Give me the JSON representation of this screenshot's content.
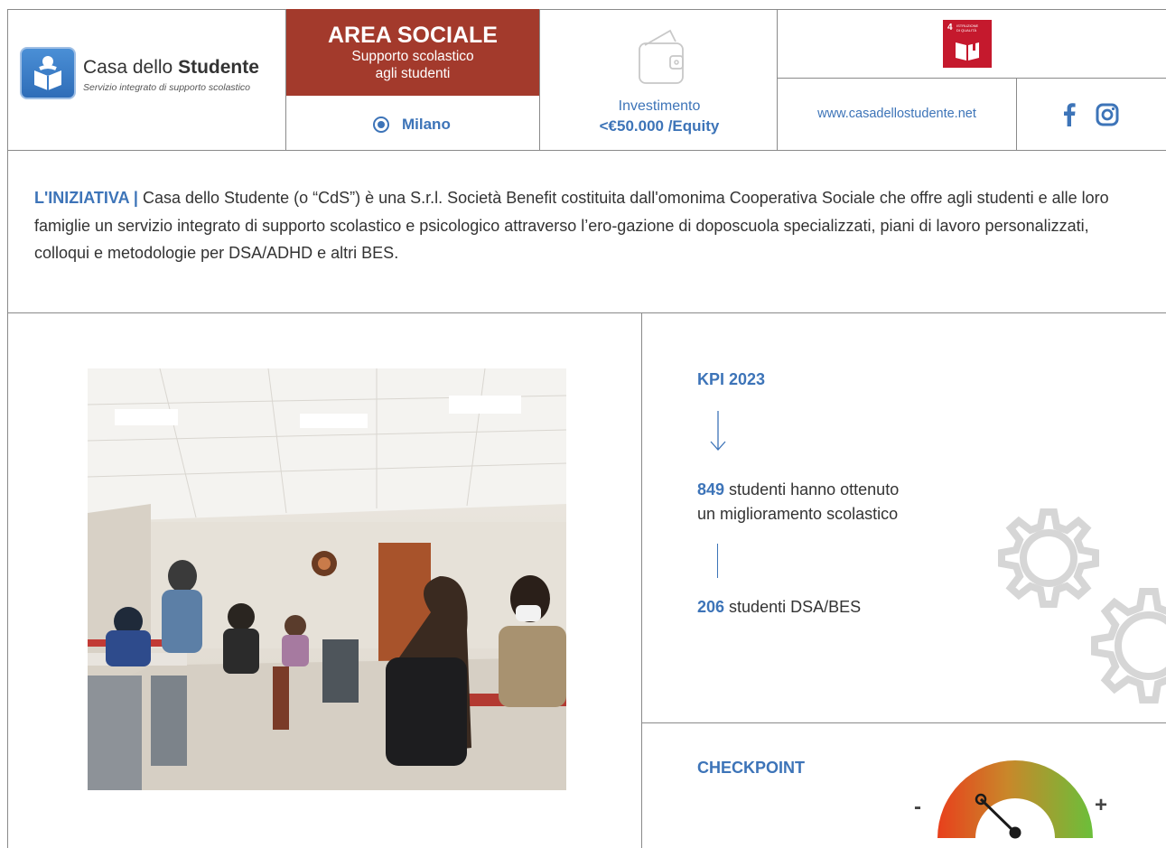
{
  "brand": {
    "name_prefix": "Casa dello ",
    "name_bold": "Studente",
    "tagline": "Servizio integrato di supporto scolastico",
    "logo_icon": "student-reading-book-icon"
  },
  "area": {
    "title": "AREA SOCIALE",
    "subtitle_line1": "Supporto scolastico",
    "subtitle_line2": "agli studenti",
    "color": "#a33a2c"
  },
  "location": {
    "icon": "location-target-icon",
    "label": "Milano"
  },
  "investment": {
    "icon": "wallet-icon",
    "label": "Investimento",
    "value": "<€50.000 /Equity"
  },
  "sdg": {
    "number": "4",
    "text_line1": "ISTRUZIONE",
    "text_line2": "DI QUALITÀ",
    "color": "#c5192d",
    "icon": "open-book-icon"
  },
  "website": "www.casadellostudente.net",
  "social": {
    "facebook_icon": "facebook-icon",
    "instagram_icon": "instagram-icon"
  },
  "initiative": {
    "label": "L'INIZIATIVA |",
    "text": " Casa dello Studente (o “CdS”) è una S.r.l. Società Benefit costituita dall'omonima Cooperativa Sociale che offre agli studenti e alle loro famiglie un servizio integrato di supporto scolastico e psicologico attraverso l’ero-gazione di doposcuola specializzati, piani di lavoro personalizzati, colloqui e metodologie per DSA/ADHD e altri BES."
  },
  "kpi": {
    "title": "KPI 2023",
    "items": [
      {
        "value": "849",
        "text_line1": " studenti hanno ottenuto",
        "text_line2": "un miglioramento scolastico"
      },
      {
        "value": "206",
        "text_line1": " studenti DSA/BES"
      }
    ]
  },
  "checkpoint": {
    "title": "CHECKPOINT",
    "minus": "-",
    "plus": "+",
    "gauge_level": 0.2
  },
  "colors": {
    "accent_blue": "#3d74b8",
    "gauge_low": "#e8401c",
    "gauge_high": "#6bbf3a"
  }
}
